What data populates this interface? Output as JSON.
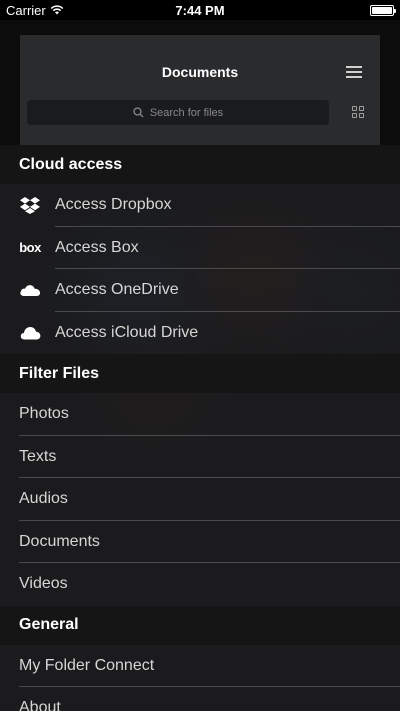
{
  "status_bar": {
    "carrier": "Carrier",
    "time": "7:44 PM",
    "battery_percent": 100
  },
  "background_screen": {
    "title": "Documents",
    "search_placeholder": "Search for files",
    "icons": [
      "menu-icon",
      "grid-view-icon",
      "search-icon"
    ]
  },
  "menu": {
    "cloud_access": {
      "header": "Cloud access",
      "items": [
        {
          "label": "Access Dropbox",
          "icon": "dropbox-icon"
        },
        {
          "label": "Access Box",
          "icon": "box-icon",
          "icon_text": "box"
        },
        {
          "label": "Access OneDrive",
          "icon": "onedrive-icon"
        },
        {
          "label": "Access iCloud Drive",
          "icon": "icloud-icon"
        }
      ]
    },
    "filter_files": {
      "header": "Filter Files",
      "items": [
        {
          "label": "Photos"
        },
        {
          "label": "Texts"
        },
        {
          "label": "Audios"
        },
        {
          "label": "Documents"
        },
        {
          "label": "Videos"
        }
      ]
    },
    "general": {
      "header": "General",
      "items": [
        {
          "label": "My Folder Connect"
        },
        {
          "label": "About"
        }
      ]
    }
  },
  "colors": {
    "menu_background": "#1e1e20",
    "header_background": "#121213",
    "separator": "#4a4a4d",
    "text_primary": "#ffffff",
    "text_secondary": "#d6d6d6"
  }
}
